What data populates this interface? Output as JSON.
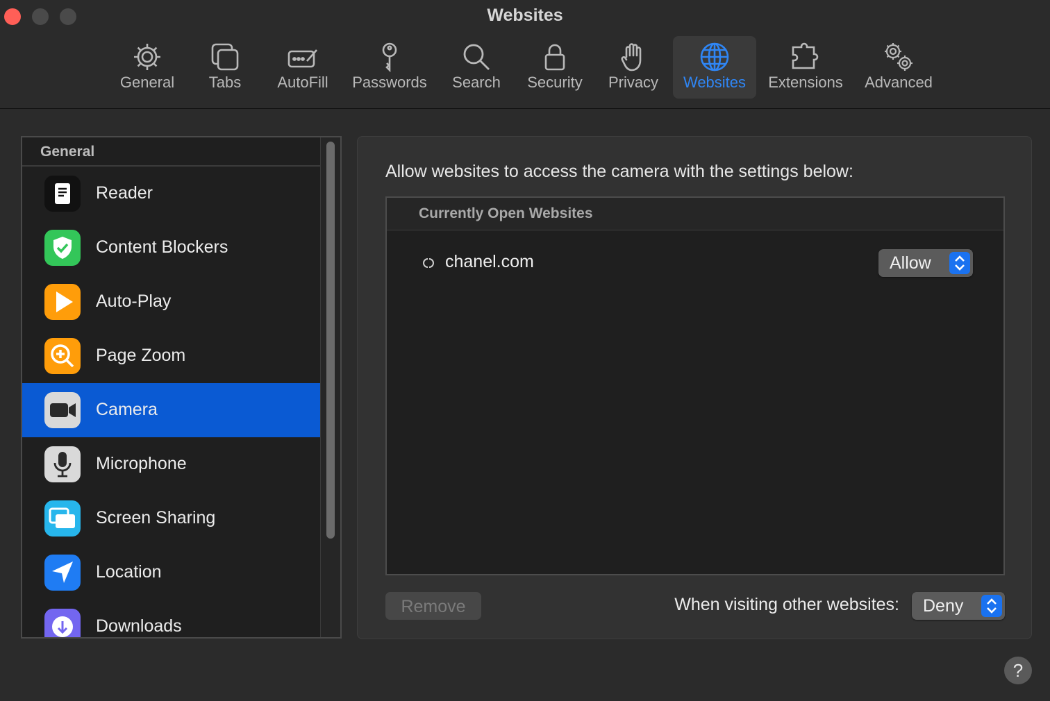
{
  "window": {
    "title": "Websites"
  },
  "toolbar": {
    "tabs": [
      {
        "label": "General",
        "icon": "gear-icon"
      },
      {
        "label": "Tabs",
        "icon": "tabs-icon"
      },
      {
        "label": "AutoFill",
        "icon": "autofill-icon"
      },
      {
        "label": "Passwords",
        "icon": "key-icon"
      },
      {
        "label": "Search",
        "icon": "magnifier-icon"
      },
      {
        "label": "Security",
        "icon": "lock-icon"
      },
      {
        "label": "Privacy",
        "icon": "hand-icon"
      },
      {
        "label": "Websites",
        "icon": "globe-icon",
        "active": true
      },
      {
        "label": "Extensions",
        "icon": "puzzle-icon"
      },
      {
        "label": "Advanced",
        "icon": "gears-icon"
      }
    ]
  },
  "sidebar": {
    "header": "General",
    "items": [
      {
        "label": "Reader",
        "icon": "reader-icon"
      },
      {
        "label": "Content Blockers",
        "icon": "shield-check-icon"
      },
      {
        "label": "Auto-Play",
        "icon": "play-icon"
      },
      {
        "label": "Page Zoom",
        "icon": "zoom-icon"
      },
      {
        "label": "Camera",
        "icon": "camera-icon",
        "selected": true
      },
      {
        "label": "Microphone",
        "icon": "microphone-icon"
      },
      {
        "label": "Screen Sharing",
        "icon": "screen-sharing-icon"
      },
      {
        "label": "Location",
        "icon": "location-arrow-icon"
      },
      {
        "label": "Downloads",
        "icon": "download-icon"
      }
    ]
  },
  "main": {
    "instruction": "Allow websites to access the camera with the settings below:",
    "table": {
      "header": "Currently Open Websites",
      "rows": [
        {
          "site": "chanel.com",
          "setting": "Allow",
          "favicon": "chanel-logo-icon"
        }
      ]
    },
    "remove_label": "Remove",
    "other_label": "When visiting other websites:",
    "other_setting": "Deny"
  },
  "help": {
    "label": "?"
  },
  "colors": {
    "accent": "#2f86f5",
    "selection": "#0a5ad3",
    "close": "#ff5f57"
  }
}
